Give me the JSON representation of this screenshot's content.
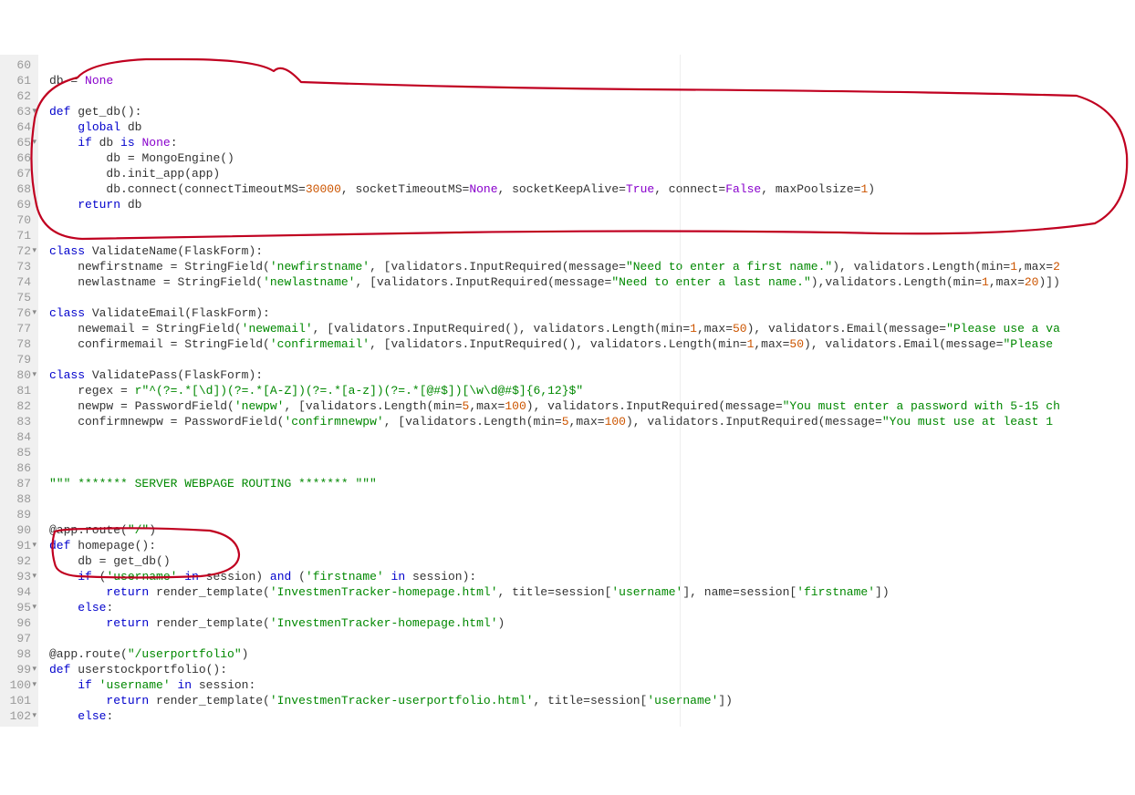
{
  "lines": [
    {
      "n": 60,
      "fold": false,
      "tokens": [
        [
          "",
          ""
        ]
      ]
    },
    {
      "n": 61,
      "fold": false,
      "tokens": [
        [
          "db ",
          ""
        ],
        [
          "=",
          "op"
        ],
        [
          " ",
          ""
        ],
        [
          "None",
          "const"
        ]
      ]
    },
    {
      "n": 62,
      "fold": false,
      "tokens": [
        [
          "",
          ""
        ]
      ]
    },
    {
      "n": 63,
      "fold": true,
      "tokens": [
        [
          "def",
          "kw"
        ],
        [
          " get_db():",
          "def"
        ]
      ]
    },
    {
      "n": 64,
      "fold": false,
      "tokens": [
        [
          "    ",
          ""
        ],
        [
          "global",
          "kw"
        ],
        [
          " db",
          ""
        ]
      ]
    },
    {
      "n": 65,
      "fold": true,
      "tokens": [
        [
          "    ",
          ""
        ],
        [
          "if",
          "kw"
        ],
        [
          " db ",
          ""
        ],
        [
          "is",
          "kw"
        ],
        [
          " ",
          ""
        ],
        [
          "None",
          "const"
        ],
        [
          ":",
          ""
        ]
      ]
    },
    {
      "n": 66,
      "fold": false,
      "tokens": [
        [
          "        db ",
          ""
        ],
        [
          "=",
          "op"
        ],
        [
          " MongoEngine()",
          ""
        ]
      ]
    },
    {
      "n": 67,
      "fold": false,
      "tokens": [
        [
          "        db.init_app(app)",
          ""
        ]
      ]
    },
    {
      "n": 68,
      "fold": false,
      "tokens": [
        [
          "        db.connect(connectTimeoutMS",
          ""
        ],
        [
          "=",
          "op"
        ],
        [
          "30000",
          "num"
        ],
        [
          ", socketTimeoutMS",
          ""
        ],
        [
          "=",
          "op"
        ],
        [
          "None",
          "const"
        ],
        [
          ", socketKeepAlive",
          ""
        ],
        [
          "=",
          "op"
        ],
        [
          "True",
          "const"
        ],
        [
          ", connect",
          ""
        ],
        [
          "=",
          "op"
        ],
        [
          "False",
          "const"
        ],
        [
          ", maxPoolsize",
          ""
        ],
        [
          "=",
          "op"
        ],
        [
          "1",
          "num"
        ],
        [
          ")",
          ""
        ]
      ]
    },
    {
      "n": 69,
      "fold": false,
      "tokens": [
        [
          "    ",
          ""
        ],
        [
          "return",
          "kw"
        ],
        [
          " db",
          ""
        ]
      ]
    },
    {
      "n": 70,
      "fold": false,
      "tokens": [
        [
          "",
          ""
        ]
      ]
    },
    {
      "n": 71,
      "fold": false,
      "tokens": [
        [
          "",
          ""
        ]
      ]
    },
    {
      "n": 72,
      "fold": true,
      "tokens": [
        [
          "class",
          "kw"
        ],
        [
          " ValidateName(FlaskForm):",
          "def"
        ]
      ]
    },
    {
      "n": 73,
      "fold": false,
      "tokens": [
        [
          "    newfirstname ",
          ""
        ],
        [
          "=",
          "op"
        ],
        [
          " StringField(",
          ""
        ],
        [
          "'newfirstname'",
          "str"
        ],
        [
          ", [validators.InputRequired(message",
          ""
        ],
        [
          "=",
          "op"
        ],
        [
          "\"Need to enter a first name.\"",
          "str"
        ],
        [
          "), validators.Length(min",
          ""
        ],
        [
          "=",
          "op"
        ],
        [
          "1",
          "num"
        ],
        [
          ",max",
          ""
        ],
        [
          "=",
          "op"
        ],
        [
          "2",
          "num"
        ]
      ]
    },
    {
      "n": 74,
      "fold": false,
      "tokens": [
        [
          "    newlastname ",
          ""
        ],
        [
          "=",
          "op"
        ],
        [
          " StringField(",
          ""
        ],
        [
          "'newlastname'",
          "str"
        ],
        [
          ", [validators.InputRequired(message",
          ""
        ],
        [
          "=",
          "op"
        ],
        [
          "\"Need to enter a last name.\"",
          "str"
        ],
        [
          "),validators.Length(min",
          ""
        ],
        [
          "=",
          "op"
        ],
        [
          "1",
          "num"
        ],
        [
          ",max",
          ""
        ],
        [
          "=",
          "op"
        ],
        [
          "20",
          "num"
        ],
        [
          ")])",
          ""
        ]
      ]
    },
    {
      "n": 75,
      "fold": false,
      "tokens": [
        [
          "",
          ""
        ]
      ]
    },
    {
      "n": 76,
      "fold": true,
      "tokens": [
        [
          "class",
          "kw"
        ],
        [
          " ValidateEmail(FlaskForm):",
          "def"
        ]
      ]
    },
    {
      "n": 77,
      "fold": false,
      "tokens": [
        [
          "    newemail ",
          ""
        ],
        [
          "=",
          "op"
        ],
        [
          " StringField(",
          ""
        ],
        [
          "'newemail'",
          "str"
        ],
        [
          ", [validators.InputRequired(), validators.Length(min",
          ""
        ],
        [
          "=",
          "op"
        ],
        [
          "1",
          "num"
        ],
        [
          ",max",
          ""
        ],
        [
          "=",
          "op"
        ],
        [
          "50",
          "num"
        ],
        [
          "), validators.Email(message",
          ""
        ],
        [
          "=",
          "op"
        ],
        [
          "\"Please use a va",
          "str"
        ]
      ]
    },
    {
      "n": 78,
      "fold": false,
      "tokens": [
        [
          "    confirmemail ",
          ""
        ],
        [
          "=",
          "op"
        ],
        [
          " StringField(",
          ""
        ],
        [
          "'confirmemail'",
          "str"
        ],
        [
          ", [validators.InputRequired(), validators.Length(min",
          ""
        ],
        [
          "=",
          "op"
        ],
        [
          "1",
          "num"
        ],
        [
          ",max",
          ""
        ],
        [
          "=",
          "op"
        ],
        [
          "50",
          "num"
        ],
        [
          "), validators.Email(message",
          ""
        ],
        [
          "=",
          "op"
        ],
        [
          "\"Please ",
          "str"
        ]
      ]
    },
    {
      "n": 79,
      "fold": false,
      "tokens": [
        [
          "",
          ""
        ]
      ]
    },
    {
      "n": 80,
      "fold": true,
      "tokens": [
        [
          "class",
          "kw"
        ],
        [
          " ValidatePass(FlaskForm):",
          "def"
        ]
      ]
    },
    {
      "n": 81,
      "fold": false,
      "tokens": [
        [
          "    regex ",
          ""
        ],
        [
          "=",
          "op"
        ],
        [
          " ",
          ""
        ],
        [
          "r\"^(?=.*[\\d])(?=.*[A-Z])(?=.*[a-z])(?=.*[@#$])[\\w\\d@#$]{6,12}$\"",
          "str"
        ]
      ]
    },
    {
      "n": 82,
      "fold": false,
      "tokens": [
        [
          "    newpw ",
          ""
        ],
        [
          "=",
          "op"
        ],
        [
          " PasswordField(",
          ""
        ],
        [
          "'newpw'",
          "str"
        ],
        [
          ", [validators.Length(min",
          ""
        ],
        [
          "=",
          "op"
        ],
        [
          "5",
          "num"
        ],
        [
          ",max",
          ""
        ],
        [
          "=",
          "op"
        ],
        [
          "100",
          "num"
        ],
        [
          "), validators.InputRequired(message",
          ""
        ],
        [
          "=",
          "op"
        ],
        [
          "\"You must enter a password with 5-15 ch",
          "str"
        ]
      ]
    },
    {
      "n": 83,
      "fold": false,
      "tokens": [
        [
          "    confirmnewpw ",
          ""
        ],
        [
          "=",
          "op"
        ],
        [
          " PasswordField(",
          ""
        ],
        [
          "'confirmnewpw'",
          "str"
        ],
        [
          ", [validators.Length(min",
          ""
        ],
        [
          "=",
          "op"
        ],
        [
          "5",
          "num"
        ],
        [
          ",max",
          ""
        ],
        [
          "=",
          "op"
        ],
        [
          "100",
          "num"
        ],
        [
          "), validators.InputRequired(message",
          ""
        ],
        [
          "=",
          "op"
        ],
        [
          "\"You must use at least 1 ",
          "str"
        ]
      ]
    },
    {
      "n": 84,
      "fold": false,
      "tokens": [
        [
          "",
          ""
        ]
      ]
    },
    {
      "n": 85,
      "fold": false,
      "tokens": [
        [
          "",
          ""
        ]
      ]
    },
    {
      "n": 86,
      "fold": false,
      "tokens": [
        [
          "",
          ""
        ]
      ]
    },
    {
      "n": 87,
      "fold": false,
      "tokens": [
        [
          "\"\"\" ******* SERVER WEBPAGE ROUTING ******* \"\"\"",
          "str"
        ]
      ]
    },
    {
      "n": 88,
      "fold": false,
      "tokens": [
        [
          "",
          ""
        ]
      ]
    },
    {
      "n": 89,
      "fold": false,
      "tokens": [
        [
          "",
          ""
        ]
      ]
    },
    {
      "n": 90,
      "fold": false,
      "tokens": [
        [
          "@app.route(",
          ""
        ],
        [
          "\"/\"",
          "str"
        ],
        [
          ")",
          ""
        ]
      ]
    },
    {
      "n": 91,
      "fold": true,
      "tokens": [
        [
          "def",
          "kw"
        ],
        [
          " homepage():",
          "def"
        ]
      ]
    },
    {
      "n": 92,
      "fold": false,
      "tokens": [
        [
          "    db ",
          ""
        ],
        [
          "=",
          "op"
        ],
        [
          " get_db()",
          ""
        ]
      ]
    },
    {
      "n": 93,
      "fold": true,
      "tokens": [
        [
          "    ",
          ""
        ],
        [
          "if",
          "kw"
        ],
        [
          " (",
          ""
        ],
        [
          "'username'",
          "str"
        ],
        [
          " ",
          ""
        ],
        [
          "in",
          "kw"
        ],
        [
          " session) ",
          ""
        ],
        [
          "and",
          "kw"
        ],
        [
          " (",
          ""
        ],
        [
          "'firstname'",
          "str"
        ],
        [
          " ",
          ""
        ],
        [
          "in",
          "kw"
        ],
        [
          " session):",
          ""
        ]
      ]
    },
    {
      "n": 94,
      "fold": false,
      "tokens": [
        [
          "        ",
          ""
        ],
        [
          "return",
          "kw"
        ],
        [
          " render_template(",
          ""
        ],
        [
          "'InvestmenTracker-homepage.html'",
          "str"
        ],
        [
          ", title",
          ""
        ],
        [
          "=",
          "op"
        ],
        [
          "session[",
          ""
        ],
        [
          "'username'",
          "str"
        ],
        [
          "], name",
          ""
        ],
        [
          "=",
          "op"
        ],
        [
          "session[",
          ""
        ],
        [
          "'firstname'",
          "str"
        ],
        [
          "])",
          ""
        ]
      ]
    },
    {
      "n": 95,
      "fold": true,
      "tokens": [
        [
          "    ",
          ""
        ],
        [
          "else",
          "kw"
        ],
        [
          ":",
          ""
        ]
      ]
    },
    {
      "n": 96,
      "fold": false,
      "tokens": [
        [
          "        ",
          ""
        ],
        [
          "return",
          "kw"
        ],
        [
          " render_template(",
          ""
        ],
        [
          "'InvestmenTracker-homepage.html'",
          "str"
        ],
        [
          ")",
          ""
        ]
      ]
    },
    {
      "n": 97,
      "fold": false,
      "tokens": [
        [
          "",
          ""
        ]
      ]
    },
    {
      "n": 98,
      "fold": false,
      "tokens": [
        [
          "@app.route(",
          ""
        ],
        [
          "\"/userportfolio\"",
          "str"
        ],
        [
          ")",
          ""
        ]
      ]
    },
    {
      "n": 99,
      "fold": true,
      "tokens": [
        [
          "def",
          "kw"
        ],
        [
          " userstockportfolio():",
          "def"
        ]
      ]
    },
    {
      "n": 100,
      "fold": true,
      "tokens": [
        [
          "    ",
          ""
        ],
        [
          "if",
          "kw"
        ],
        [
          " ",
          ""
        ],
        [
          "'username'",
          "str"
        ],
        [
          " ",
          ""
        ],
        [
          "in",
          "kw"
        ],
        [
          " session:",
          ""
        ]
      ]
    },
    {
      "n": 101,
      "fold": false,
      "tokens": [
        [
          "        ",
          ""
        ],
        [
          "return",
          "kw"
        ],
        [
          " render_template(",
          ""
        ],
        [
          "'InvestmenTracker-userportfolio.html'",
          "str"
        ],
        [
          ", title",
          ""
        ],
        [
          "=",
          "op"
        ],
        [
          "session[",
          ""
        ],
        [
          "'username'",
          "str"
        ],
        [
          "])",
          ""
        ]
      ]
    },
    {
      "n": 102,
      "fold": true,
      "tokens": [
        [
          "    ",
          ""
        ],
        [
          "else",
          "kw"
        ],
        [
          ":",
          ""
        ]
      ]
    }
  ]
}
